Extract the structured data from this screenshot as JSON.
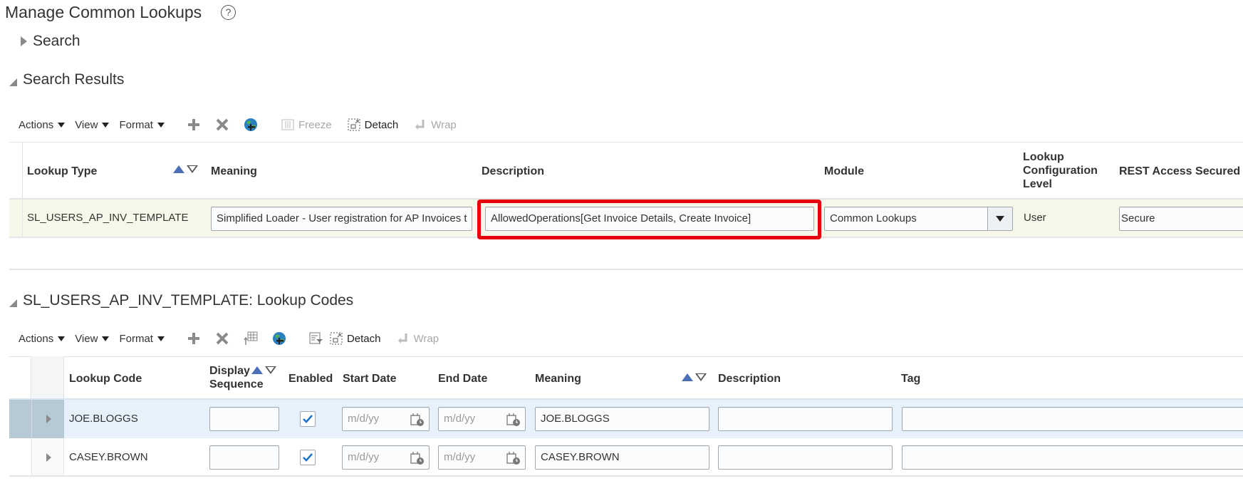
{
  "page": {
    "title": "Manage Common Lookups",
    "help_icon": "help-circle-icon"
  },
  "search_section": {
    "label": "Search",
    "expanded": false
  },
  "results_section": {
    "label": "Search Results",
    "expanded": true,
    "toolbar": {
      "menus": [
        "Actions",
        "View",
        "Format"
      ],
      "icons": [
        "add-icon",
        "delete-icon",
        "web-service-icon"
      ],
      "freeze_label": "Freeze",
      "detach_label": "Detach",
      "wrap_label": "Wrap"
    },
    "columns": {
      "lookup_type": "Lookup Type",
      "meaning": "Meaning",
      "description": "Description",
      "module": "Module",
      "config_level": "Lookup Configuration Level",
      "config_level_lines": [
        "Lookup",
        "Configuration",
        "Level"
      ],
      "rest_access": "REST Access Secured"
    },
    "rows": [
      {
        "lookup_type": "SL_USERS_AP_INV_TEMPLATE",
        "meaning": "Simplified Loader - User registration for AP Invoices t",
        "description": "AllowedOperations[Get Invoice Details, Create Invoice]",
        "module": "Common Lookups",
        "config_level": "User",
        "rest_access": "Secure"
      }
    ],
    "highlight_color": "#e8000b",
    "row_color": "#f7f7ea"
  },
  "codes_section": {
    "label": "SL_USERS_AP_INV_TEMPLATE: Lookup Codes",
    "expanded": true,
    "toolbar": {
      "menus": [
        "Actions",
        "View",
        "Format"
      ],
      "icons": [
        "add-icon",
        "delete-icon",
        "export-table-icon",
        "web-service-icon",
        "query-by-example-icon"
      ],
      "detach_label": "Detach",
      "wrap_label": "Wrap"
    },
    "columns": {
      "lookup_code": "Lookup Code",
      "display_sequence_1": "Display",
      "display_sequence_2": "Sequence",
      "enabled": "Enabled",
      "start_date": "Start Date",
      "end_date": "End Date",
      "meaning": "Meaning",
      "description": "Description",
      "tag": "Tag"
    },
    "date_placeholder": "m/d/yy",
    "rows": [
      {
        "lookup_code": "JOE.BLOGGS",
        "display_sequence": "",
        "enabled": true,
        "start_date": "",
        "end_date": "",
        "meaning": "JOE.BLOGGS",
        "description": "",
        "tag": "",
        "selected": true
      },
      {
        "lookup_code": "CASEY.BROWN",
        "display_sequence": "",
        "enabled": true,
        "start_date": "",
        "end_date": "",
        "meaning": "CASEY.BROWN",
        "description": "",
        "tag": "",
        "selected": false
      }
    ],
    "selected_row_color": "#e6f1fc"
  }
}
